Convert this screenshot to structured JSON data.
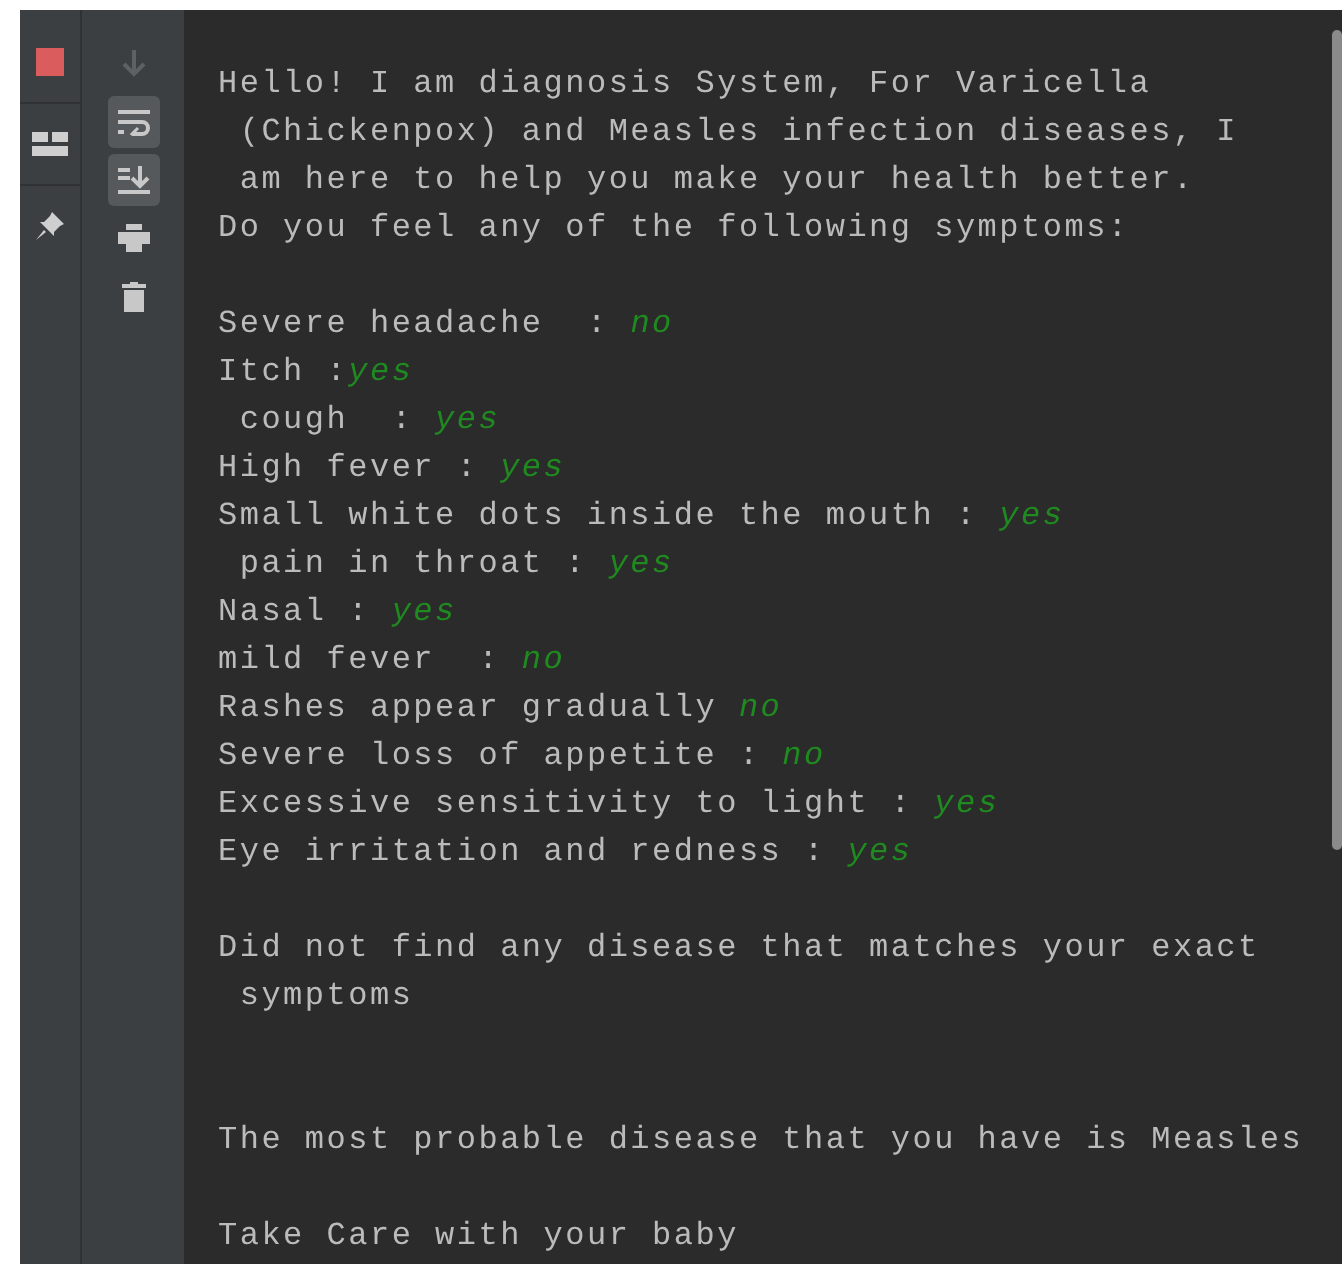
{
  "left_toolbar": [
    {
      "kind": "stop",
      "disabled": false
    },
    {
      "kind": "layout",
      "disabled": false
    },
    {
      "kind": "pin",
      "disabled": false
    }
  ],
  "console_toolbar": [
    {
      "kind": "down",
      "selected": false,
      "disabled": true
    },
    {
      "kind": "wrap",
      "selected": true,
      "disabled": false
    },
    {
      "kind": "scroll-end",
      "selected": true,
      "disabled": false
    },
    {
      "kind": "print",
      "selected": false,
      "disabled": false
    },
    {
      "kind": "trash",
      "selected": false,
      "disabled": false
    }
  ],
  "console_lines": [
    {
      "kind": "text",
      "text": "Hello! I am diagnosis System, For Varicella"
    },
    {
      "kind": "text",
      "text": " (Chickenpox) and Measles infection diseases, I"
    },
    {
      "kind": "text",
      "text": " am here to help you make your health better."
    },
    {
      "kind": "text",
      "text": "Do you feel any of the following symptoms:"
    },
    {
      "kind": "blank"
    },
    {
      "kind": "answer",
      "label": "Severe headache  : ",
      "answer": "no"
    },
    {
      "kind": "answer",
      "label": "Itch :",
      "answer": "yes"
    },
    {
      "kind": "answer",
      "label": " cough  : ",
      "answer": "yes"
    },
    {
      "kind": "answer",
      "label": "High fever : ",
      "answer": "yes"
    },
    {
      "kind": "answer",
      "label": "Small white dots inside the mouth : ",
      "answer": "yes"
    },
    {
      "kind": "answer",
      "label": " pain in throat : ",
      "answer": "yes"
    },
    {
      "kind": "answer",
      "label": "Nasal : ",
      "answer": "yes"
    },
    {
      "kind": "answer",
      "label": "mild fever  : ",
      "answer": "no"
    },
    {
      "kind": "answer",
      "label": "Rashes appear gradually ",
      "answer": "no"
    },
    {
      "kind": "answer",
      "label": "Severe loss of appetite : ",
      "answer": "no"
    },
    {
      "kind": "answer",
      "label": "Excessive sensitivity to light : ",
      "answer": "yes"
    },
    {
      "kind": "answer",
      "label": "Eye irritation and redness : ",
      "answer": "yes"
    },
    {
      "kind": "blank"
    },
    {
      "kind": "text",
      "text": "Did not find any disease that matches your exact"
    },
    {
      "kind": "text",
      "text": " symptoms"
    },
    {
      "kind": "blank"
    },
    {
      "kind": "blank"
    },
    {
      "kind": "text",
      "text": "The most probable disease that you have is Measles"
    },
    {
      "kind": "blank"
    },
    {
      "kind": "text",
      "text": "Take Care with your baby"
    }
  ]
}
